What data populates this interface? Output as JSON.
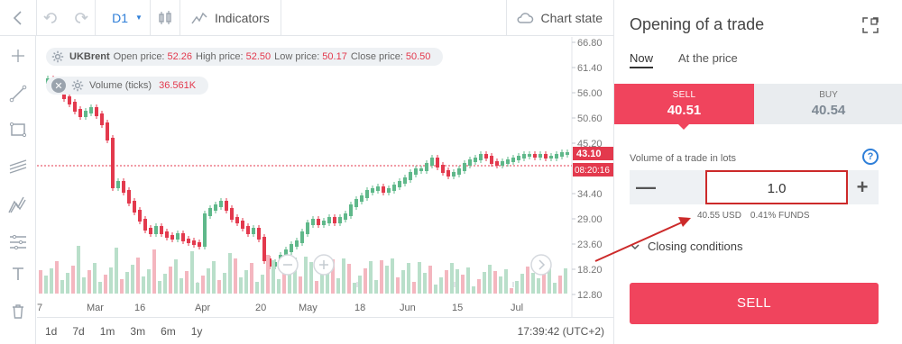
{
  "toolbar": {
    "timeframe": "D1",
    "indicators_label": "Indicators",
    "chart_state_label": "Chart state"
  },
  "legend": {
    "symbol": "UKBrent",
    "open_label": "Open price:",
    "open_value": "52.26",
    "high_label": "High price:",
    "high_value": "52.50",
    "low_label": "Low price:",
    "low_value": "50.17",
    "close_label": "Close price:",
    "close_value": "50.50",
    "volume_label": "Volume (ticks)",
    "volume_value": "36.561K"
  },
  "y_axis": {
    "ticks": [
      "66.80",
      "61.40",
      "56.00",
      "50.60",
      "45.20",
      "34.40",
      "29.00",
      "23.60",
      "18.20",
      "12.80"
    ],
    "price_tag": "43.10",
    "time_tag": "08:20:16"
  },
  "x_axis": {
    "ticks": [
      "7",
      "Mar",
      "16",
      "Apr",
      "20",
      "May",
      "18",
      "Jun",
      "15",
      "Jul"
    ]
  },
  "periods": [
    "1d",
    "7d",
    "1m",
    "3m",
    "6m",
    "1y"
  ],
  "clock": "17:39:42 (UTC+2)",
  "panel": {
    "title": "Opening of a trade",
    "tabs": [
      "Now",
      "At the price"
    ],
    "sell_label": "SELL",
    "sell_price": "40.51",
    "buy_label": "BUY",
    "buy_price": "40.54",
    "volume_label": "Volume of a trade in lots",
    "help_glyph": "?",
    "quantity": "1.0",
    "funds_usd": "40.55 USD",
    "funds_pct": "0.41% FUNDS",
    "closing_label": "Closing conditions",
    "sell_button_label": "SELL"
  },
  "colors": {
    "up": "#5fb88a",
    "down": "#e3394d",
    "sell": "#f0445d",
    "accent": "#2f7fd8",
    "annotation": "#cc2a2a"
  },
  "icons": [
    "back-arrow-icon",
    "undo-icon",
    "redo-icon",
    "candlestick-icon",
    "indicators-icon",
    "cloud-icon",
    "crosshair-icon",
    "trendline-icon",
    "rectangle-icon",
    "channel-icon",
    "fibonacci-icon",
    "levels-icon",
    "text-tool-icon",
    "trash-icon",
    "gear-icon",
    "expand-icon",
    "chevron-down-icon"
  ]
}
